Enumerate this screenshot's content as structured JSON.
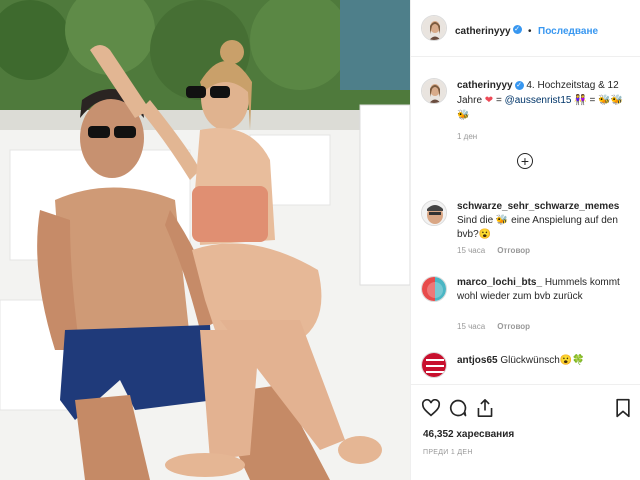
{
  "post": {
    "username": "catherinyyy",
    "follow_label": "Последване",
    "caption_text": "4. Hochzeitstag & 12 Jahre",
    "caption_heart": "❤",
    "caption_equals": "=",
    "caption_mention": "@aussenrist15",
    "caption_tail": "👭 = 🐝🐝🐝",
    "caption_time": "1 ден"
  },
  "comments": [
    {
      "username": "schwarze_sehr_schwarze_memes",
      "text": "Sind die 🐝 eine Anspielung auf den bvb?😮",
      "time": "15 часа",
      "reply_label": "Отговор"
    },
    {
      "username": "marco_lochi_bts_",
      "text": "Hummels kommt wohl wieder zum bvb zurück",
      "time": "15 часа",
      "reply_label": "Отговор"
    },
    {
      "username": "antjos65",
      "text": "Glückwünsch😮🍀",
      "time": "",
      "reply_label": ""
    }
  ],
  "footer": {
    "likes": "46,352 харесвания",
    "date": "ПРЕДИ 1 ДЕН"
  },
  "colors": {
    "accent": "#3897f0",
    "heart": "#ed4956",
    "text": "#262626",
    "muted": "#999999"
  }
}
